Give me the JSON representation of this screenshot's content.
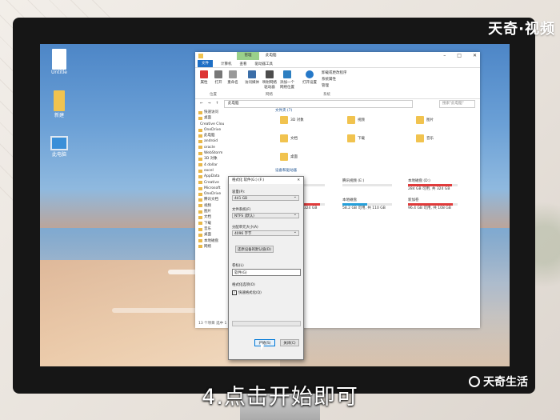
{
  "brand": {
    "text": "天奇·视频"
  },
  "caption": {
    "text": "4.点击开始即可"
  },
  "logo": {
    "text": "天奇生活"
  },
  "desktop_icons": [
    {
      "label": "Untitle"
    },
    {
      "label": "新建"
    },
    {
      "label": "此电脑"
    }
  ],
  "explorer": {
    "title_tab": "管理",
    "title": "此电脑",
    "ribbon_tabs": [
      "文件",
      "计算机",
      "查看",
      "驱动器工具"
    ],
    "ribbon_buttons": [
      "属性",
      "打开",
      "重命名",
      "访问媒体",
      "映射网络驱动器",
      "添加一个网络位置",
      "打开设置",
      "卸载或更改程序",
      "系统属性",
      "管理"
    ],
    "ribbon_groups": [
      "位置",
      "网络",
      "系统"
    ],
    "address": "此电脑",
    "search_placeholder": "搜索\"此电脑\"",
    "nav": [
      "快速访问",
      "桌面",
      "Creative Cloud Files",
      "OneDrive",
      "此电脑",
      "android",
      "oracle",
      "WebStorm",
      "3D 对象",
      "4 dollar",
      "excel",
      "AppData",
      "Creative",
      "Microsoft",
      "OneDrive",
      "腾讯文档",
      "视频",
      "图片",
      "文档",
      "下载",
      "音乐",
      "桌面",
      "本地磁盘",
      "网络"
    ],
    "folders_header": "文件夹 (7)",
    "folders": [
      "3D 对象",
      "视频",
      "图片",
      "文档",
      "下载",
      "音乐",
      "桌面"
    ],
    "devices_header": "设备和驱动器",
    "drives": [
      {
        "name": "本地磁盘 (C:)",
        "info": "可用, 共 441 GB",
        "fill": 0.55,
        "color": "#26a0da"
      },
      {
        "name": "腾讯视频 (E:)",
        "info": "",
        "fill": 0.0,
        "color": "#26a0da"
      },
      {
        "name": "本地磁盘 (D:)",
        "info": "284 GB 可用, 共 324 GB",
        "fill": 0.88,
        "color": "#e03c3c"
      },
      {
        "name": "新加卷 (F:)",
        "info": "324 GB 可用, 共 324 GB",
        "fill": 0.9,
        "color": "#e03c3c"
      },
      {
        "name": "本地磁盘",
        "info": "58.2 GB 可用, 共 110 GB",
        "fill": 0.5,
        "color": "#26a0da"
      },
      {
        "name": "新加卷",
        "info": "96.4 GB 可用, 共 108 GB",
        "fill": 0.9,
        "color": "#e03c3c"
      }
    ],
    "statusbar": "13 个项目  选中 1 个项目"
  },
  "dialog": {
    "title": "格式化 软件(G:) (F:)",
    "capacity_label": "容量(P):",
    "capacity_value": "441 GB",
    "fs_label": "文件系统(F)",
    "fs_value": "NTFS (默认)",
    "alloc_label": "分配单元大小(A)",
    "alloc_value": "4096 字节",
    "restore_button": "还原设备的默认值(D)",
    "volume_label": "卷标(L)",
    "volume_value": "软件(G)",
    "format_options": "格式化选项(O)",
    "quick_format": "快速格式化(Q)",
    "start_button": "开始(S)",
    "close_button": "关闭(C)"
  }
}
